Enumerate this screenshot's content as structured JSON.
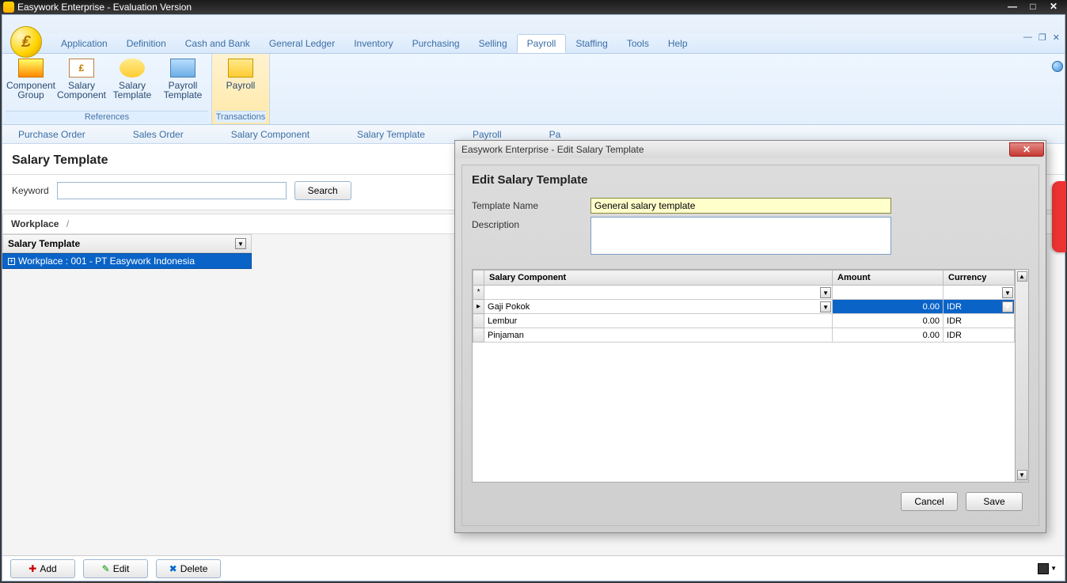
{
  "window": {
    "title": "Easywork Enterprise - Evaluation Version"
  },
  "menu": {
    "items": [
      "Application",
      "Definition",
      "Cash and Bank",
      "General Ledger",
      "Inventory",
      "Purchasing",
      "Selling",
      "Payroll",
      "Staffing",
      "Tools",
      "Help"
    ],
    "active": "Payroll"
  },
  "ribbon": {
    "groups": [
      {
        "label": "References",
        "items": [
          {
            "label": "Component Group"
          },
          {
            "label": "Salary Component"
          },
          {
            "label": "Salary Template"
          },
          {
            "label": "Payroll Template"
          }
        ]
      },
      {
        "label": "Transactions",
        "items": [
          {
            "label": "Payroll"
          }
        ]
      }
    ]
  },
  "doc_tabs": [
    "Purchase Order",
    "Sales Order",
    "Salary Component",
    "Salary Template",
    "Payroll",
    "Pa"
  ],
  "page": {
    "title": "Salary Template",
    "keyword_label": "Keyword",
    "search_label": "Search",
    "breadcrumb_root": "Workplace",
    "breadcrumb_sep": "/",
    "tree_header": "Salary Template",
    "tree_row": "Workplace : 001 - PT Easywork Indonesia"
  },
  "bottom": {
    "add": "Add",
    "edit": "Edit",
    "delete": "Delete"
  },
  "dialog": {
    "title": "Easywork Enterprise - Edit Salary Template",
    "heading": "Edit Salary Template",
    "template_name_label": "Template Name",
    "template_name_value": "General salary template",
    "description_label": "Description",
    "description_value": "",
    "grid": {
      "cols": {
        "c1": "Salary Component",
        "c2": "Amount",
        "c3": "Currency"
      },
      "rows": [
        {
          "component": "Gaji Pokok",
          "amount": "0.00",
          "currency": "IDR",
          "selected": true
        },
        {
          "component": "Lembur",
          "amount": "0.00",
          "currency": "IDR",
          "selected": false
        },
        {
          "component": "Pinjaman",
          "amount": "0.00",
          "currency": "IDR",
          "selected": false
        }
      ]
    },
    "cancel": "Cancel",
    "save": "Save"
  }
}
